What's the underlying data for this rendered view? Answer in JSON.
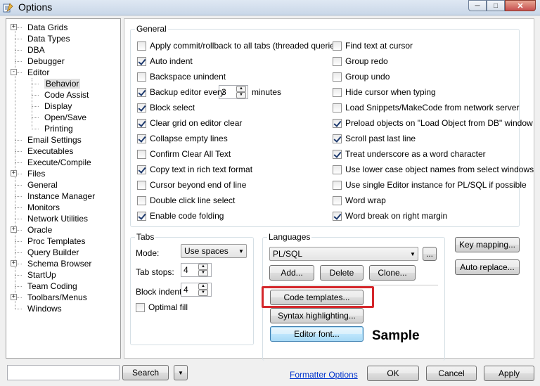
{
  "window": {
    "title": "Options",
    "buttons": [
      "minimize",
      "maximize",
      "close"
    ]
  },
  "tree": {
    "items": [
      {
        "label": "Data Grids",
        "expandable": true
      },
      {
        "label": "Data Types",
        "expandable": false
      },
      {
        "label": "DBA",
        "expandable": false
      },
      {
        "label": "Debugger",
        "expandable": false
      },
      {
        "label": "Editor",
        "expandable": true,
        "expanded": true
      },
      {
        "label": "Behavior",
        "child": true,
        "selected": true
      },
      {
        "label": "Code Assist",
        "child": true
      },
      {
        "label": "Display",
        "child": true
      },
      {
        "label": "Open/Save",
        "child": true
      },
      {
        "label": "Printing",
        "child": true
      },
      {
        "label": "Email Settings",
        "expandable": false
      },
      {
        "label": "Executables",
        "expandable": false
      },
      {
        "label": "Execute/Compile",
        "expandable": false
      },
      {
        "label": "Files",
        "expandable": true
      },
      {
        "label": "General",
        "expandable": false
      },
      {
        "label": "Instance Manager",
        "expandable": false
      },
      {
        "label": "Monitors",
        "expandable": false
      },
      {
        "label": "Network Utilities",
        "expandable": false
      },
      {
        "label": "Oracle",
        "expandable": true
      },
      {
        "label": "Proc Templates",
        "expandable": false
      },
      {
        "label": "Query Builder",
        "expandable": false
      },
      {
        "label": "Schema Browser",
        "expandable": true
      },
      {
        "label": "StartUp",
        "expandable": false
      },
      {
        "label": "Team Coding",
        "expandable": false
      },
      {
        "label": "Toolbars/Menus",
        "expandable": true
      },
      {
        "label": "Windows",
        "expandable": false
      }
    ]
  },
  "general": {
    "legend": "General",
    "left": [
      {
        "label": "Apply commit/rollback to all tabs (threaded queries)",
        "checked": false
      },
      {
        "label": "Auto indent",
        "checked": true
      },
      {
        "label": "Backspace unindent",
        "checked": false
      },
      {
        "label": "Backup editor every",
        "checked": true
      },
      {
        "label": "Block select",
        "checked": true
      },
      {
        "label": "Clear grid on editor clear",
        "checked": true
      },
      {
        "label": "Collapse empty lines",
        "checked": true
      },
      {
        "label": "Confirm Clear All Text",
        "checked": false
      },
      {
        "label": "Copy text in rich text format",
        "checked": true
      },
      {
        "label": "Cursor beyond end of line",
        "checked": false
      },
      {
        "label": "Double click line select",
        "checked": false
      },
      {
        "label": "Enable code folding",
        "checked": true
      }
    ],
    "backup_value": "3",
    "backup_unit": "minutes",
    "right": [
      {
        "label": "Find text at cursor",
        "checked": false
      },
      {
        "label": "Group redo",
        "checked": false
      },
      {
        "label": "Group undo",
        "checked": false
      },
      {
        "label": "Hide cursor when typing",
        "checked": false
      },
      {
        "label": "Load Snippets/MakeCode from network server",
        "checked": false
      },
      {
        "label": "Preload objects on \"Load Object from DB\" window",
        "checked": true
      },
      {
        "label": "Scroll past last line",
        "checked": true
      },
      {
        "label": "Treat underscore as a word character",
        "checked": true
      },
      {
        "label": "Use lower case object names from select windows",
        "checked": false
      },
      {
        "label": "Use single Editor instance for PL/SQL if possible",
        "checked": false
      },
      {
        "label": "Word wrap",
        "checked": false
      },
      {
        "label": "Word break on right margin",
        "checked": true
      }
    ]
  },
  "tabs": {
    "legend": "Tabs",
    "mode_label": "Mode:",
    "mode_value": "Use spaces",
    "tab_stops_label": "Tab stops:",
    "tab_stops_value": "4",
    "block_indent_label": "Block indent:",
    "block_indent_value": "4",
    "optimal_fill_label": "Optimal fill",
    "optimal_fill_checked": false
  },
  "languages": {
    "legend": "Languages",
    "selected": "PL/SQL",
    "more_label": "...",
    "add_label": "Add...",
    "delete_label": "Delete",
    "clone_label": "Clone...",
    "code_templates_label": "Code templates...",
    "syntax_label": "Syntax highlighting...",
    "editor_font_label": "Editor font...",
    "sample_label": "Sample"
  },
  "side_buttons": {
    "key_mapping": "Key mapping...",
    "auto_replace": "Auto replace..."
  },
  "footer": {
    "search_label": "Search",
    "formatter_link": "Formatter Options",
    "ok_label": "OK",
    "cancel_label": "Cancel",
    "apply_label": "Apply"
  },
  "colors": {
    "highlight": "#d4272b",
    "link": "#0033cc"
  }
}
